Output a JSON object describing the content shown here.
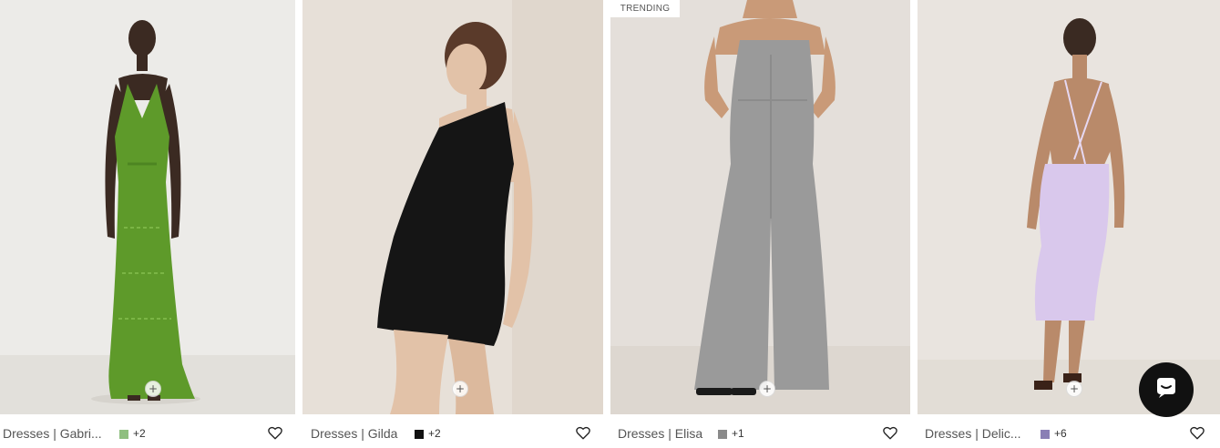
{
  "products": [
    {
      "title": "Dresses | Gabri...",
      "swatch_color": "#8fbf7f",
      "more_colors": "+2",
      "badge": "",
      "background": "#ecebe8",
      "garment_color": "#5e9a2a",
      "skin_color": "#3b2a22"
    },
    {
      "title": "Dresses | Gilda",
      "swatch_color": "#111111",
      "more_colors": "+2",
      "badge": "",
      "background": "#e7e0d8",
      "garment_color": "#151515",
      "skin_color": "#e2c2a8"
    },
    {
      "title": "Dresses | Elisa",
      "swatch_color": "#8a8a8a",
      "more_colors": "+1",
      "badge": "TRENDING",
      "background": "#e4dfda",
      "garment_color": "#9a9a9a",
      "skin_color": "#c99a78"
    },
    {
      "title": "Dresses | Delic...",
      "swatch_color": "#8a7fb5",
      "more_colors": "+6",
      "badge": "",
      "background": "#e9e4df",
      "garment_color": "#d9c8ec",
      "skin_color": "#b98a6a"
    }
  ],
  "icons": {
    "quick_add": "plus-icon",
    "favorite": "heart-icon",
    "chat": "chat-bubble-icon"
  },
  "quick_add_symbol": "+"
}
